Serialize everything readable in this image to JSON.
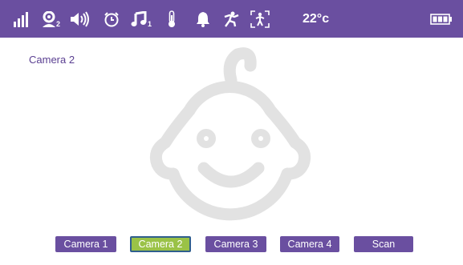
{
  "status_bar": {
    "icons": [
      {
        "name": "signal-icon"
      },
      {
        "name": "camera-user-icon",
        "sub": "2"
      },
      {
        "name": "speaker-volume-icon"
      },
      {
        "name": "alarm-clock-icon"
      },
      {
        "name": "music-note-icon",
        "sub": "1"
      },
      {
        "name": "thermometer-icon"
      },
      {
        "name": "bell-icon"
      },
      {
        "name": "motion-figure-icon"
      },
      {
        "name": "zoom-frame-icon"
      },
      {
        "name": "battery-icon"
      }
    ],
    "temperature": "22°c",
    "camera_badge": "2",
    "music_badge": "1"
  },
  "main": {
    "camera_label": "Camera 2",
    "placeholder_icon": "baby-face-icon"
  },
  "camera_tabs": {
    "items": [
      {
        "label": "Camera 1",
        "active": false
      },
      {
        "label": "Camera 2",
        "active": true
      },
      {
        "label": "Camera 3",
        "active": false
      },
      {
        "label": "Camera 4",
        "active": false
      },
      {
        "label": "Scan",
        "active": false
      }
    ]
  },
  "colors": {
    "bar": "#6a4fa0",
    "active_tab": "#9ac247",
    "active_border": "#2f5e8e",
    "label_text": "#5a3f91",
    "face_stroke": "#e2e2e2"
  }
}
